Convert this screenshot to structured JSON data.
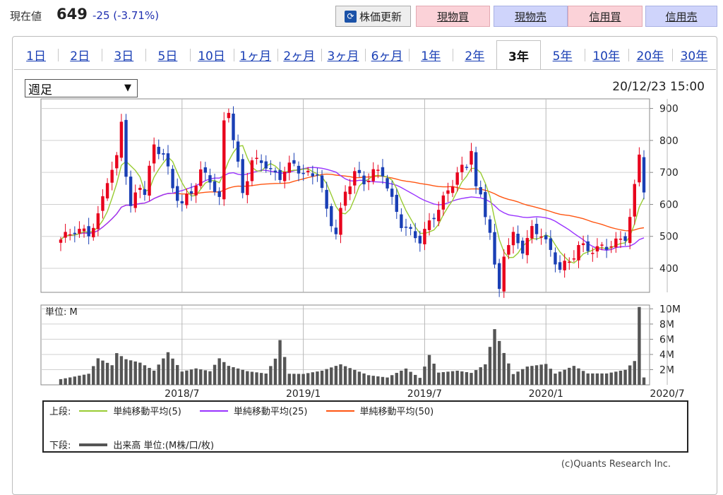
{
  "header": {
    "price_label": "現在値",
    "price_value": "649",
    "change_abs": "-25",
    "change_pct": "(-3.71%)",
    "update_button": "株価更新",
    "update_icon": "refresh-icon",
    "trade_buttons": [
      "現物買",
      "現物売",
      "信用買",
      "信用売"
    ]
  },
  "tabs": {
    "items": [
      "1日",
      "2日",
      "3日",
      "5日",
      "10日",
      "1ヶ月",
      "2ヶ月",
      "3ヶ月",
      "6ヶ月",
      "1年",
      "2年",
      "3年",
      "5年",
      "10年",
      "20年",
      "30年"
    ],
    "active": "3年"
  },
  "controls": {
    "period_select": "週足",
    "timestamp": "20/12/23 15:00"
  },
  "colors": {
    "up": "#e8001c",
    "down": "#1a3fb5",
    "ma5": "#99cc33",
    "ma25": "#9933ff",
    "ma50": "#ff5511",
    "volume": "#555555"
  },
  "legend": {
    "upper_label": "上段:",
    "ma5": "単純移動平均(5)",
    "ma25": "単純移動平均(25)",
    "ma50": "単純移動平均(50)",
    "lower_label": "下段:",
    "volume": "出来高 単位:(M株/口/枚)"
  },
  "credit": "(c)Quants Research Inc.",
  "chart_data": {
    "type": "candlestick",
    "price_axis": {
      "ticks": [
        400,
        500,
        600,
        700,
        800,
        900
      ],
      "range": [
        325,
        930
      ]
    },
    "volume_axis": {
      "unit_label": "単位: M",
      "ticks": [
        "2M",
        "4M",
        "6M",
        "8M",
        "10M"
      ],
      "tick_values": [
        2,
        4,
        6,
        8,
        10
      ],
      "range": [
        0,
        10.5
      ]
    },
    "x_labels": [
      "2018/7",
      "2019/1",
      "2019/7",
      "2020/1",
      "2020/7"
    ],
    "x_label_weeks": [
      26,
      52,
      78,
      104,
      130
    ],
    "price_anchors": [
      [
        0,
        490
      ],
      [
        3,
        520
      ],
      [
        6,
        510
      ],
      [
        8,
        560
      ],
      [
        10,
        680
      ],
      [
        12,
        740
      ],
      [
        13,
        860
      ],
      [
        14,
        700
      ],
      [
        15,
        590
      ],
      [
        17,
        660
      ],
      [
        18,
        640
      ],
      [
        20,
        780
      ],
      [
        22,
        760
      ],
      [
        24,
        650
      ],
      [
        26,
        600
      ],
      [
        28,
        640
      ],
      [
        30,
        700
      ],
      [
        32,
        680
      ],
      [
        34,
        610
      ],
      [
        35,
        860
      ],
      [
        36,
        900
      ],
      [
        37,
        800
      ],
      [
        39,
        640
      ],
      [
        41,
        730
      ],
      [
        43,
        740
      ],
      [
        45,
        700
      ],
      [
        47,
        690
      ],
      [
        50,
        730
      ],
      [
        52,
        690
      ],
      [
        55,
        700
      ],
      [
        57,
        580
      ],
      [
        59,
        510
      ],
      [
        61,
        640
      ],
      [
        63,
        700
      ],
      [
        65,
        670
      ],
      [
        67,
        700
      ],
      [
        69,
        700
      ],
      [
        71,
        610
      ],
      [
        73,
        540
      ],
      [
        75,
        510
      ],
      [
        77,
        490
      ],
      [
        79,
        540
      ],
      [
        81,
        590
      ],
      [
        83,
        640
      ],
      [
        85,
        700
      ],
      [
        87,
        720
      ],
      [
        88,
        780
      ],
      [
        89,
        650
      ],
      [
        90,
        620
      ],
      [
        92,
        520
      ],
      [
        93,
        400
      ],
      [
        94,
        330
      ],
      [
        95,
        450
      ],
      [
        97,
        500
      ],
      [
        99,
        460
      ],
      [
        101,
        520
      ],
      [
        103,
        510
      ],
      [
        105,
        450
      ],
      [
        107,
        400
      ],
      [
        109,
        420
      ],
      [
        111,
        470
      ],
      [
        113,
        460
      ],
      [
        115,
        460
      ],
      [
        117,
        470
      ],
      [
        119,
        480
      ],
      [
        121,
        500
      ],
      [
        122,
        560
      ],
      [
        123,
        650
      ],
      [
        124,
        760
      ],
      [
        125,
        650
      ]
    ],
    "volume_anchors": [
      [
        0,
        1.0
      ],
      [
        6,
        1.8
      ],
      [
        8,
        4.2
      ],
      [
        11,
        3.0
      ],
      [
        12,
        4.8
      ],
      [
        14,
        3.8
      ],
      [
        17,
        3.2
      ],
      [
        20,
        2.0
      ],
      [
        23,
        4.5
      ],
      [
        26,
        1.8
      ],
      [
        29,
        2.2
      ],
      [
        32,
        1.8
      ],
      [
        34,
        3.5
      ],
      [
        36,
        2.5
      ],
      [
        40,
        1.8
      ],
      [
        44,
        1.5
      ],
      [
        46,
        3.5
      ],
      [
        47,
        6.0
      ],
      [
        49,
        1.5
      ],
      [
        52,
        1.5
      ],
      [
        56,
        2.0
      ],
      [
        60,
        3.0
      ],
      [
        62,
        2.5
      ],
      [
        66,
        1.5
      ],
      [
        70,
        1.2
      ],
      [
        74,
        2.8
      ],
      [
        77,
        1.2
      ],
      [
        79,
        5.0
      ],
      [
        81,
        2.0
      ],
      [
        85,
        2.2
      ],
      [
        88,
        1.8
      ],
      [
        91,
        3.0
      ],
      [
        93,
        8.0
      ],
      [
        95,
        4.5
      ],
      [
        97,
        1.5
      ],
      [
        100,
        2.5
      ],
      [
        104,
        2.8
      ],
      [
        106,
        1.5
      ],
      [
        110,
        2.5
      ],
      [
        113,
        1.5
      ],
      [
        117,
        1.5
      ],
      [
        121,
        2.0
      ],
      [
        123,
        3.2
      ],
      [
        124,
        10.5
      ],
      [
        125,
        1.0
      ]
    ],
    "weeks": 126
  }
}
